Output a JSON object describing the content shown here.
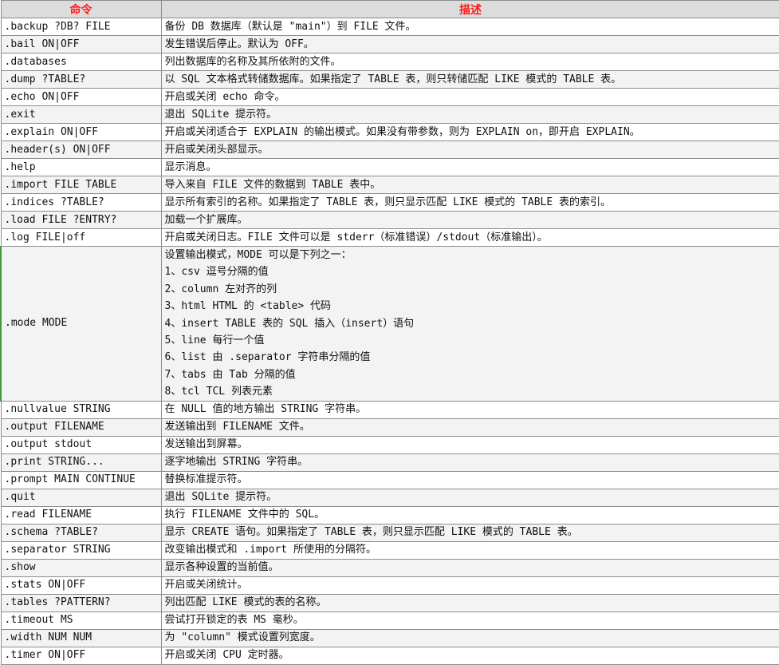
{
  "header": {
    "command": "命令",
    "description": "描述"
  },
  "rows": [
    {
      "cmd": ".backup ?DB? FILE",
      "desc": "备份 DB 数据库（默认是 \"main\"）到 FILE 文件。"
    },
    {
      "cmd": ".bail ON|OFF",
      "desc": "发生错误后停止。默认为 OFF。"
    },
    {
      "cmd": ".databases",
      "desc": "列出数据库的名称及其所依附的文件。"
    },
    {
      "cmd": ".dump ?TABLE?",
      "desc": "以 SQL 文本格式转储数据库。如果指定了 TABLE 表，则只转储匹配 LIKE 模式的 TABLE 表。"
    },
    {
      "cmd": ".echo ON|OFF",
      "desc": "开启或关闭 echo 命令。"
    },
    {
      "cmd": ".exit",
      "desc": "退出 SQLite 提示符。"
    },
    {
      "cmd": ".explain ON|OFF",
      "desc": "开启或关闭适合于 EXPLAIN 的输出模式。如果没有带参数，则为 EXPLAIN on，即开启 EXPLAIN。"
    },
    {
      "cmd": ".header(s) ON|OFF",
      "desc": "开启或关闭头部显示。"
    },
    {
      "cmd": ".help",
      "desc": "显示消息。"
    },
    {
      "cmd": ".import FILE TABLE",
      "desc": "导入来自 FILE 文件的数据到 TABLE 表中。"
    },
    {
      "cmd": ".indices ?TABLE?",
      "desc": "显示所有索引的名称。如果指定了 TABLE 表，则只显示匹配 LIKE 模式的 TABLE 表的索引。"
    },
    {
      "cmd": ".load FILE ?ENTRY?",
      "desc": "加载一个扩展库。"
    },
    {
      "cmd": ".log FILE|off",
      "desc": "开启或关闭日志。FILE 文件可以是 stderr（标准错误）/stdout（标准输出）。"
    }
  ],
  "mode_row": {
    "cmd": ".mode MODE",
    "lines": [
      "设置输出模式，MODE 可以是下列之一：",
      "1、csv 逗号分隔的值",
      "2、column 左对齐的列",
      "3、html HTML 的 <table> 代码",
      "4、insert TABLE 表的 SQL 插入（insert）语句",
      "5、line 每行一个值",
      "6、list 由 .separator 字符串分隔的值",
      "7、tabs 由 Tab 分隔的值",
      "8、tcl TCL 列表元素"
    ]
  },
  "rows_after": [
    {
      "cmd": ".nullvalue STRING",
      "desc": "在 NULL 值的地方输出 STRING 字符串。"
    },
    {
      "cmd": ".output FILENAME",
      "desc": "发送输出到 FILENAME 文件。"
    },
    {
      "cmd": ".output stdout",
      "desc": "发送输出到屏幕。"
    },
    {
      "cmd": ".print STRING...",
      "desc": "逐字地输出 STRING 字符串。"
    },
    {
      "cmd": ".prompt MAIN CONTINUE",
      "desc": "替换标准提示符。"
    },
    {
      "cmd": ".quit",
      "desc": "退出 SQLite 提示符。"
    },
    {
      "cmd": ".read FILENAME",
      "desc": "执行 FILENAME 文件中的 SQL。"
    },
    {
      "cmd": ".schema ?TABLE?",
      "desc": "显示 CREATE 语句。如果指定了 TABLE 表，则只显示匹配 LIKE 模式的 TABLE 表。"
    },
    {
      "cmd": ".separator STRING",
      "desc": "改变输出模式和 .import 所使用的分隔符。"
    },
    {
      "cmd": ".show",
      "desc": "显示各种设置的当前值。"
    },
    {
      "cmd": ".stats ON|OFF",
      "desc": "开启或关闭统计。"
    },
    {
      "cmd": ".tables ?PATTERN?",
      "desc": "列出匹配 LIKE 模式的表的名称。"
    },
    {
      "cmd": ".timeout MS",
      "desc": "尝试打开锁定的表 MS 毫秒。"
    },
    {
      "cmd": ".width NUM NUM",
      "desc": "为 \"column\" 模式设置列宽度。"
    },
    {
      "cmd": ".timer ON|OFF",
      "desc": "开启或关闭 CPU 定时器。"
    }
  ],
  "colors": {
    "header_text": "#ff1a1a",
    "header_bg": "#dcdcdc",
    "border": "#8c8c8c",
    "mode_row_accent": "#3c9c3c"
  }
}
